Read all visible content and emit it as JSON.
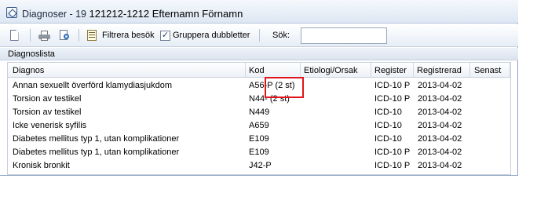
{
  "window": {
    "title_prefix": "Diagnoser - 19",
    "patient": "121212-1212 Efternamn Förnamn"
  },
  "toolbar": {
    "filter_label": "Filtrera besök",
    "group_label": "Gruppera dubbletter",
    "group_checked": "✓",
    "search_label": "Sök:",
    "search_value": ""
  },
  "panel": {
    "title": "Diagnoslista"
  },
  "table": {
    "columns": [
      "Diagnos",
      "Kod",
      "Etiologi/Orsak",
      "Register",
      "Registrerad",
      "Senast"
    ],
    "rows": [
      {
        "diagnos": "Annan sexuellt överförd klamydiasjukdom",
        "kod": "A56-P (2 st)",
        "etiologi": "",
        "register": "ICD-10 P",
        "registrerad": "2013-04-02",
        "senast": ""
      },
      {
        "diagnos": "Torsion av testikel",
        "kod": "N44- (2 st)",
        "etiologi": "",
        "register": "ICD-10 P",
        "registrerad": "2013-04-02",
        "senast": ""
      },
      {
        "diagnos": "Torsion av testikel",
        "kod": "N449",
        "etiologi": "",
        "register": "ICD-10",
        "registrerad": "2013-04-02",
        "senast": ""
      },
      {
        "diagnos": "Icke venerisk syfilis",
        "kod": "A659",
        "etiologi": "",
        "register": "ICD-10",
        "registrerad": "2013-04-02",
        "senast": ""
      },
      {
        "diagnos": "Diabetes mellitus typ 1, utan komplikationer",
        "kod": "E109",
        "etiologi": "",
        "register": "ICD-10",
        "registrerad": "2013-04-02",
        "senast": ""
      },
      {
        "diagnos": "Diabetes mellitus typ 1, utan komplikationer",
        "kod": "E109",
        "etiologi": "",
        "register": "ICD-10 P",
        "registrerad": "2013-04-02",
        "senast": ""
      },
      {
        "diagnos": "Kronisk bronkit",
        "kod": "J42-P",
        "etiologi": "",
        "register": "ICD-10 P",
        "registrerad": "2013-04-02",
        "senast": ""
      }
    ]
  },
  "annotation": {
    "color": "#e0141b"
  }
}
